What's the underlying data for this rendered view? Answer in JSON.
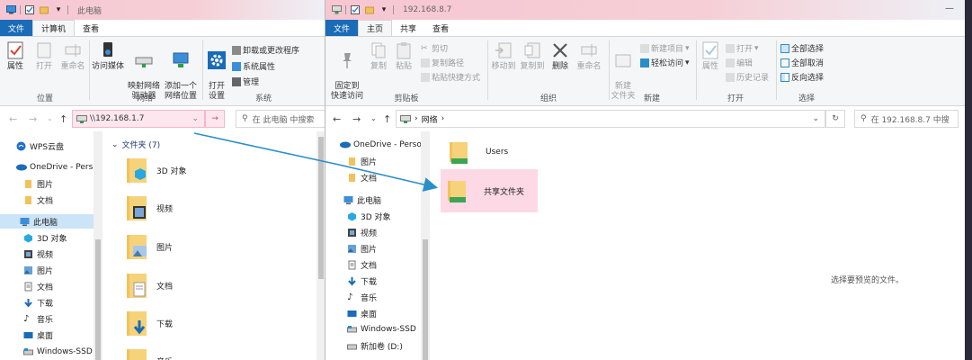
{
  "left_window": {
    "title": "此电脑",
    "tabs": [
      {
        "label": "文件"
      },
      {
        "label": "计算机"
      },
      {
        "label": "查看"
      }
    ],
    "groups": [
      {
        "label": "位置"
      },
      {
        "label": "网络"
      },
      {
        "label": "系统"
      }
    ],
    "location_buttons": [
      {
        "label": "属性"
      },
      {
        "label": "打开"
      },
      {
        "label": "重命名"
      }
    ],
    "network_buttons": [
      {
        "label": "访问媒体"
      },
      {
        "label": "映射网络\n驱动器"
      },
      {
        "label": "添加一个\n网络位置"
      }
    ],
    "system_big_button": {
      "label": "打开\n设置"
    },
    "system_small_buttons": [
      {
        "label": "卸载或更改程序"
      },
      {
        "label": "系统属性"
      },
      {
        "label": "管理"
      }
    ],
    "address": "\\\\192.168.1.7",
    "search_placeholder": "在 此电脑 中搜索",
    "nav_items": [
      {
        "label": "WPS云盘",
        "icon": "cloud-icon"
      },
      {
        "label": "OneDrive - Perso",
        "icon": "onedrive-icon"
      },
      {
        "label": "图片",
        "icon": "folder-icon"
      },
      {
        "label": "文档",
        "icon": "folder-icon"
      },
      {
        "label": "此电脑",
        "icon": "pc-icon"
      },
      {
        "label": "3D 对象",
        "icon": "3d-icon"
      },
      {
        "label": "视频",
        "icon": "video-icon"
      },
      {
        "label": "图片",
        "icon": "pictures-icon"
      },
      {
        "label": "文档",
        "icon": "documents-icon"
      },
      {
        "label": "下载",
        "icon": "download-icon"
      },
      {
        "label": "音乐",
        "icon": "music-icon"
      },
      {
        "label": "桌面",
        "icon": "desktop-icon"
      },
      {
        "label": "Windows-SSD",
        "icon": "drive-icon"
      }
    ],
    "group_header": "文件夹 (7)",
    "folders": [
      {
        "label": "3D 对象"
      },
      {
        "label": "视频"
      },
      {
        "label": "图片"
      },
      {
        "label": "文档"
      },
      {
        "label": "下载"
      },
      {
        "label": "音乐"
      }
    ]
  },
  "right_window": {
    "title": "192.168.8.7",
    "tabs": [
      {
        "label": "文件"
      },
      {
        "label": "主页"
      },
      {
        "label": "共享"
      },
      {
        "label": "查看"
      }
    ],
    "groups": [
      {
        "label": "剪贴板"
      },
      {
        "label": "组织"
      },
      {
        "label": "新建"
      },
      {
        "label": "打开"
      },
      {
        "label": "选择"
      }
    ],
    "clipboard_big": [
      {
        "label": "固定到\n快速访问"
      },
      {
        "label": "复制"
      },
      {
        "label": "粘贴"
      }
    ],
    "clipboard_small": [
      {
        "label": "剪切"
      },
      {
        "label": "复制路径"
      },
      {
        "label": "粘贴快捷方式"
      }
    ],
    "organize_buttons": [
      {
        "label": "移动到"
      },
      {
        "label": "复制到"
      },
      {
        "label": "删除"
      },
      {
        "label": "重命名"
      }
    ],
    "new_big": {
      "label": "新建\n文件夹"
    },
    "new_small": [
      {
        "label": "新建项目"
      },
      {
        "label": "轻松访问"
      }
    ],
    "open_big": {
      "label": "属性"
    },
    "open_small": [
      {
        "label": "打开"
      },
      {
        "label": "编辑"
      },
      {
        "label": "历史记录"
      }
    ],
    "select_small": [
      {
        "label": "全部选择"
      },
      {
        "label": "全部取消"
      },
      {
        "label": "反向选择"
      }
    ],
    "address": "网络",
    "search_placeholder": "在 192.168.8.7 中搜",
    "nav_items": [
      {
        "label": "OneDrive - Perso",
        "icon": "onedrive-icon"
      },
      {
        "label": "图片",
        "icon": "folder-icon"
      },
      {
        "label": "文档",
        "icon": "folder-icon"
      },
      {
        "label": "此电脑",
        "icon": "pc-icon"
      },
      {
        "label": "3D 对象",
        "icon": "3d-icon"
      },
      {
        "label": "视频",
        "icon": "video-icon"
      },
      {
        "label": "图片",
        "icon": "pictures-icon"
      },
      {
        "label": "文档",
        "icon": "documents-icon"
      },
      {
        "label": "下载",
        "icon": "download-icon"
      },
      {
        "label": "音乐",
        "icon": "music-icon"
      },
      {
        "label": "桌面",
        "icon": "desktop-icon"
      },
      {
        "label": "Windows-SSD",
        "icon": "drive-icon"
      },
      {
        "label": "新加卷 (D:)",
        "icon": "drive-icon"
      }
    ],
    "shares": [
      {
        "label": "Users"
      },
      {
        "label": "共享文件夹"
      }
    ],
    "preview_text": "选择要预览的文件。"
  },
  "colors": {
    "accent": "#1a6bb8",
    "selection": "#cce4f7",
    "highlight": "#fcd9e4",
    "arrow": "#2a8ec9"
  }
}
